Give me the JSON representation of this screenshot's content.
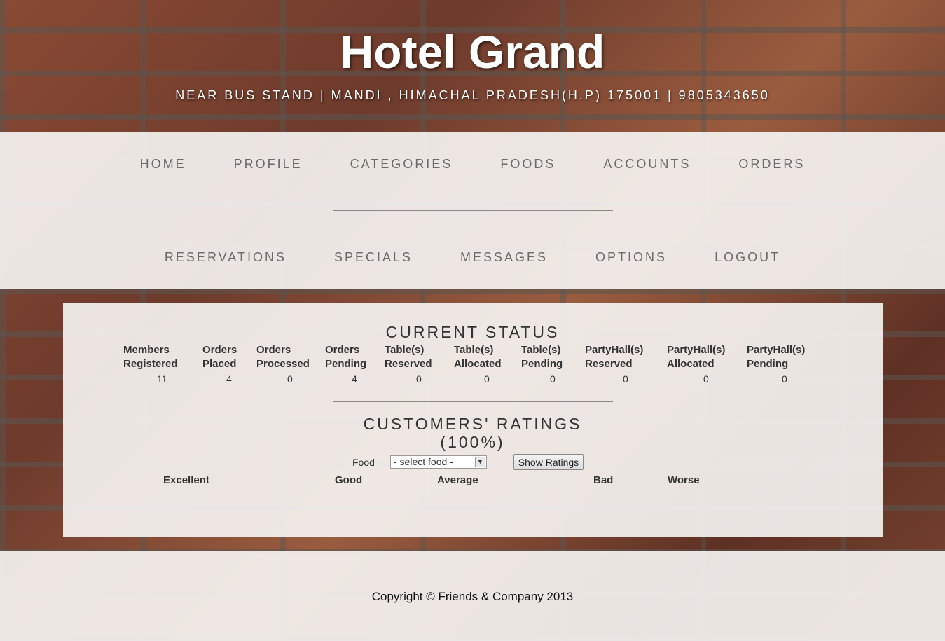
{
  "header": {
    "title": "Hotel Grand",
    "address": "NEAR BUS STAND | MANDI , HIMACHAL PRADESH(H.P) 175001 | 9805343650"
  },
  "nav": {
    "row1": [
      "HOME",
      "PROFILE",
      "CATEGORIES",
      "FOODS",
      "ACCOUNTS",
      "ORDERS"
    ],
    "row2": [
      "RESERVATIONS",
      "SPECIALS",
      "MESSAGES",
      "OPTIONS",
      "LOGOUT"
    ]
  },
  "status": {
    "title": "CURRENT STATUS",
    "columns": [
      {
        "l1": "Members",
        "l2": "Registered",
        "value": "11"
      },
      {
        "l1": "Orders",
        "l2": "Placed",
        "value": "4"
      },
      {
        "l1": "Orders",
        "l2": "Processed",
        "value": "0"
      },
      {
        "l1": "Orders",
        "l2": "Pending",
        "value": "4"
      },
      {
        "l1": "Table(s)",
        "l2": "Reserved",
        "value": "0"
      },
      {
        "l1": "Table(s)",
        "l2": "Allocated",
        "value": "0"
      },
      {
        "l1": "Table(s)",
        "l2": "Pending",
        "value": "0"
      },
      {
        "l1": "PartyHall(s)",
        "l2": "Reserved",
        "value": "0"
      },
      {
        "l1": "PartyHall(s)",
        "l2": "Allocated",
        "value": "0"
      },
      {
        "l1": "PartyHall(s)",
        "l2": "Pending",
        "value": "0"
      }
    ]
  },
  "ratings": {
    "title": "CUSTOMERS' RATINGS",
    "percent": "(100%)",
    "food_label": "Food",
    "select_value": "- select food -",
    "button": "Show Ratings",
    "headers": [
      "Excellent",
      "Good",
      "Average",
      "Bad",
      "Worse"
    ]
  },
  "footer": {
    "copyright": "Copyright © Friends & Company 2013"
  }
}
